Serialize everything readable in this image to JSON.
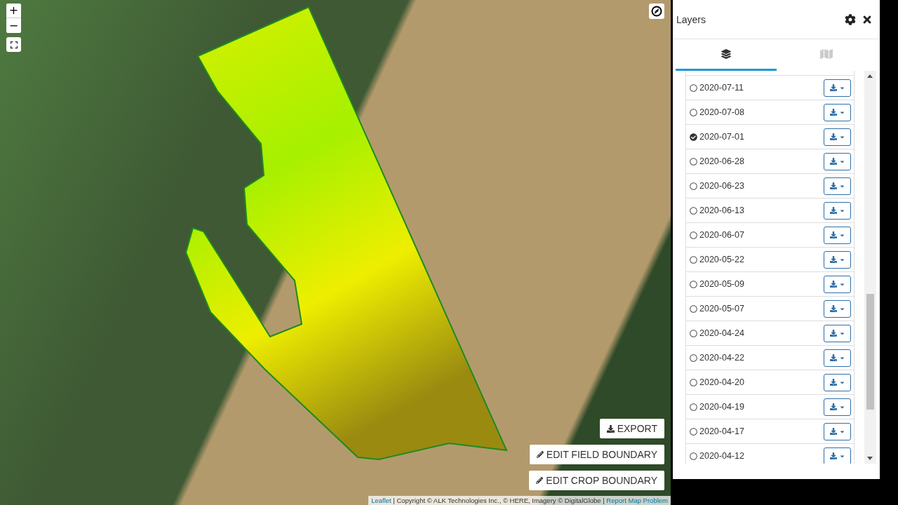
{
  "map": {
    "controls": {
      "zoom_in": "+",
      "zoom_out": "−"
    },
    "actions": [
      {
        "kind": "export",
        "label": "EXPORT"
      },
      {
        "kind": "edit",
        "label": "EDIT FIELD BOUNDARY"
      },
      {
        "kind": "edit",
        "label": "EDIT CROP BOUNDARY"
      }
    ],
    "attribution": {
      "link": "Leaflet",
      "text": " | Copyright © ALK Technologies Inc., © HERE, Imagery © DigitalGlobe | ",
      "report": "Report Map Problem"
    }
  },
  "panel": {
    "title": "Layers",
    "tabs": [
      {
        "kind": "layers",
        "selected": true
      },
      {
        "kind": "map",
        "selected": false
      }
    ],
    "dates": [
      {
        "label": "2020-07-11",
        "selected": false
      },
      {
        "label": "2020-07-08",
        "selected": false
      },
      {
        "label": "2020-07-01",
        "selected": true
      },
      {
        "label": "2020-06-28",
        "selected": false
      },
      {
        "label": "2020-06-23",
        "selected": false
      },
      {
        "label": "2020-06-13",
        "selected": false
      },
      {
        "label": "2020-06-07",
        "selected": false
      },
      {
        "label": "2020-05-22",
        "selected": false
      },
      {
        "label": "2020-05-09",
        "selected": false
      },
      {
        "label": "2020-05-07",
        "selected": false
      },
      {
        "label": "2020-04-24",
        "selected": false
      },
      {
        "label": "2020-04-22",
        "selected": false
      },
      {
        "label": "2020-04-20",
        "selected": false
      },
      {
        "label": "2020-04-19",
        "selected": false
      },
      {
        "label": "2020-04-17",
        "selected": false
      },
      {
        "label": "2020-04-12",
        "selected": false
      }
    ]
  }
}
